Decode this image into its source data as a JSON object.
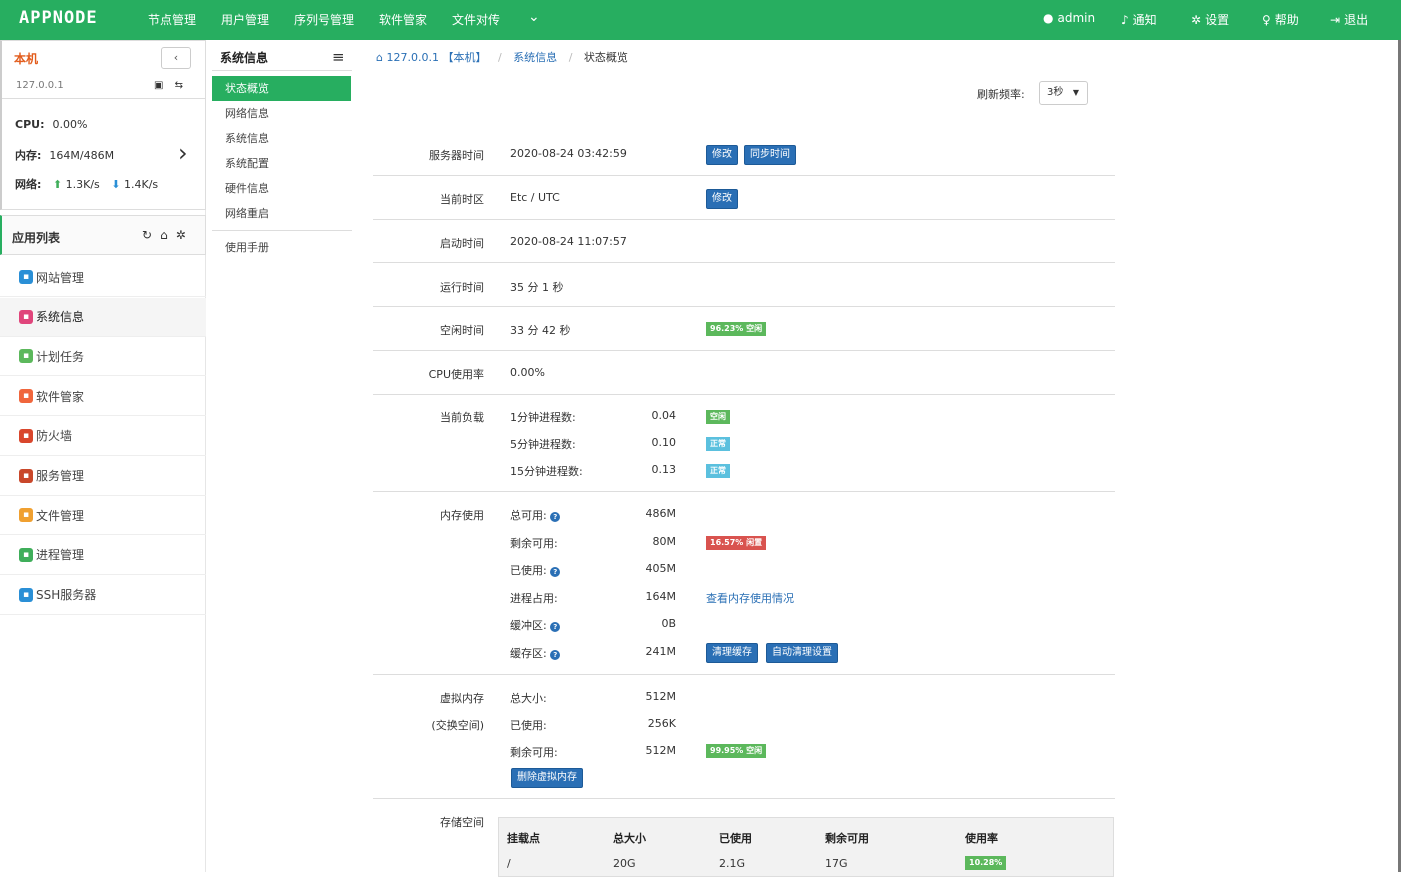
{
  "topbar": {
    "logo": "APPNODE",
    "nav": [
      "节点管理",
      "用户管理",
      "序列号管理",
      "软件管家",
      "文件对传"
    ],
    "more_icon": "chevron-down-circle-icon",
    "user": "admin",
    "notify": "通知",
    "settings": "设置",
    "help": "帮助",
    "logout": "退出"
  },
  "host": {
    "title": "本机",
    "collapse": "‹",
    "ip": "127.0.0.1",
    "cpu_label": "CPU:",
    "cpu_value": "0.00%",
    "mem_label": "内存:",
    "mem_value": "164M/486M",
    "net_label": "网络:",
    "net_up": "1.3K/s",
    "net_down": "1.4K/s"
  },
  "apps": {
    "title": "应用列表",
    "items": [
      {
        "label": "网站管理",
        "color": "#2a8fd6",
        "icon": "globe-icon"
      },
      {
        "label": "系统信息",
        "color": "#e0457b",
        "icon": "info-icon"
      },
      {
        "label": "计划任务",
        "color": "#5cb85c",
        "icon": "calendar-icon"
      },
      {
        "label": "软件管家",
        "color": "#f0663c",
        "icon": "package-icon"
      },
      {
        "label": "防火墙",
        "color": "#d9462c",
        "icon": "firewall-icon"
      },
      {
        "label": "服务管理",
        "color": "#c9472a",
        "icon": "service-icon"
      },
      {
        "label": "文件管理",
        "color": "#f0a030",
        "icon": "folder-icon"
      },
      {
        "label": "进程管理",
        "color": "#3fae5a",
        "icon": "process-icon"
      },
      {
        "label": "SSH服务器",
        "color": "#2a8fd6",
        "icon": "terminal-icon"
      }
    ]
  },
  "submenu": {
    "title": "系统信息",
    "items": [
      "状态概览",
      "网络信息",
      "系统信息",
      "系统配置",
      "硬件信息",
      "网络重启"
    ],
    "manual": "使用手册"
  },
  "breadcrumb": {
    "host": "127.0.0.1 【本机】",
    "section": "系统信息",
    "current": "状态概览"
  },
  "refresh": {
    "label": "刷新频率:",
    "value": "3秒"
  },
  "status": {
    "server_time_label": "服务器时间",
    "server_time": "2020-08-24 03:42:59",
    "edit_btn": "修改",
    "sync_btn": "同步时间",
    "tz_label": "当前时区",
    "tz": "Etc / UTC",
    "boot_label": "启动时间",
    "boot": "2020-08-24 11:07:57",
    "uptime_label": "运行时间",
    "uptime": "35 分 1 秒",
    "idle_label": "空闲时间",
    "idle": "33 分 42 秒",
    "idle_badge": "96.23% 空闲",
    "cpu_label": "CPU使用率",
    "cpu": "0.00%",
    "load_label": "当前负载",
    "load": [
      {
        "name": "1分钟进程数:",
        "value": "0.04",
        "badge": "空闲",
        "color": "#5cb85c"
      },
      {
        "name": "5分钟进程数:",
        "value": "0.10",
        "badge": "正常",
        "color": "#5bc0de"
      },
      {
        "name": "15分钟进程数:",
        "value": "0.13",
        "badge": "正常",
        "color": "#5bc0de"
      }
    ],
    "mem_label": "内存使用",
    "mem": [
      {
        "name": "总可用:",
        "value": "486M"
      },
      {
        "name": "剩余可用:",
        "value": "80M"
      },
      {
        "name": "已使用:",
        "value": "405M"
      },
      {
        "name": "进程占用:",
        "value": "164M"
      },
      {
        "name": "缓冲区:",
        "value": "0B"
      },
      {
        "name": "缓存区:",
        "value": "241M"
      }
    ],
    "mem_badge": "16.57% 闲置",
    "mem_link": "查看内存使用情况",
    "clear_cache_btn": "清理缓存",
    "auto_clean_btn": "自动清理设置",
    "swap_label_1": "虚拟内存",
    "swap_label_2": "(交换空间)",
    "swap": [
      {
        "name": "总大小:",
        "value": "512M"
      },
      {
        "name": "已使用:",
        "value": "256K"
      },
      {
        "name": "剩余可用:",
        "value": "512M"
      }
    ],
    "swap_badge": "99.95% 空闲",
    "delete_swap_btn": "删除虚拟内存",
    "storage_label": "存储空间",
    "storage_headers": [
      "挂载点",
      "总大小",
      "已使用",
      "剩余可用",
      "使用率"
    ],
    "storage_row": [
      "/",
      "20G",
      "2.1G",
      "17G",
      "10.28%"
    ]
  }
}
